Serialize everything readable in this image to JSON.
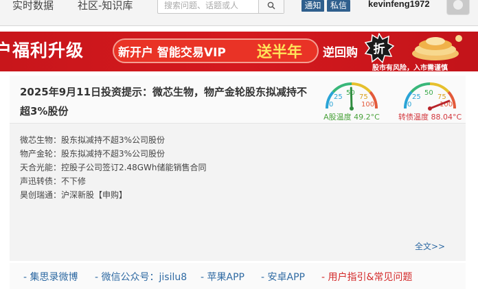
{
  "topnav": {
    "links": [
      "实时数据",
      "社区-知识库"
    ],
    "search_placeholder": "搜索问题、话题或人",
    "notify_label": "通知",
    "message_label": "私信",
    "username": "kevinfeng1972"
  },
  "banner": {
    "text1": "户福利升级",
    "text2": "新开户 智能交易VIP",
    "text3": "送半年",
    "text4": "逆回购",
    "badge": "折",
    "note": "股市有风险，入市需谨慎",
    "colors": {
      "bg": "#c8161b",
      "highlight": "#ffe35a"
    }
  },
  "post": {
    "title": "2025年9月11日投资提示：微芯生物，物产金轮股东拟减持不超3%股份",
    "lines": [
      "微芯生物：股东拟减持不超3%公司股份",
      "物产金轮：股东拟减持不超3%公司股份",
      "天合光能：控股子公司签订2.48GWh储能销售合同",
      "声迅转债：不下修",
      "昊创瑞通：沪深新股【申购】"
    ],
    "more_label": "全文>>"
  },
  "gauges": [
    {
      "label": "A股温度 49.2°C",
      "value": 49.2,
      "ticks": [
        "0",
        "25",
        "50",
        "75",
        "100"
      ],
      "color": "#4aa23b"
    },
    {
      "label": "转债温度 88.04°C",
      "value": 88.04,
      "ticks": [
        "0",
        "25",
        "50",
        "75",
        "100"
      ],
      "color": "#d2373d"
    }
  ],
  "footer": {
    "links": [
      "- 集思录微博",
      "- 微信公众号：jisilu8",
      "- 苹果APP",
      "- 安卓APP",
      "- 用户指引&常见问题"
    ]
  }
}
